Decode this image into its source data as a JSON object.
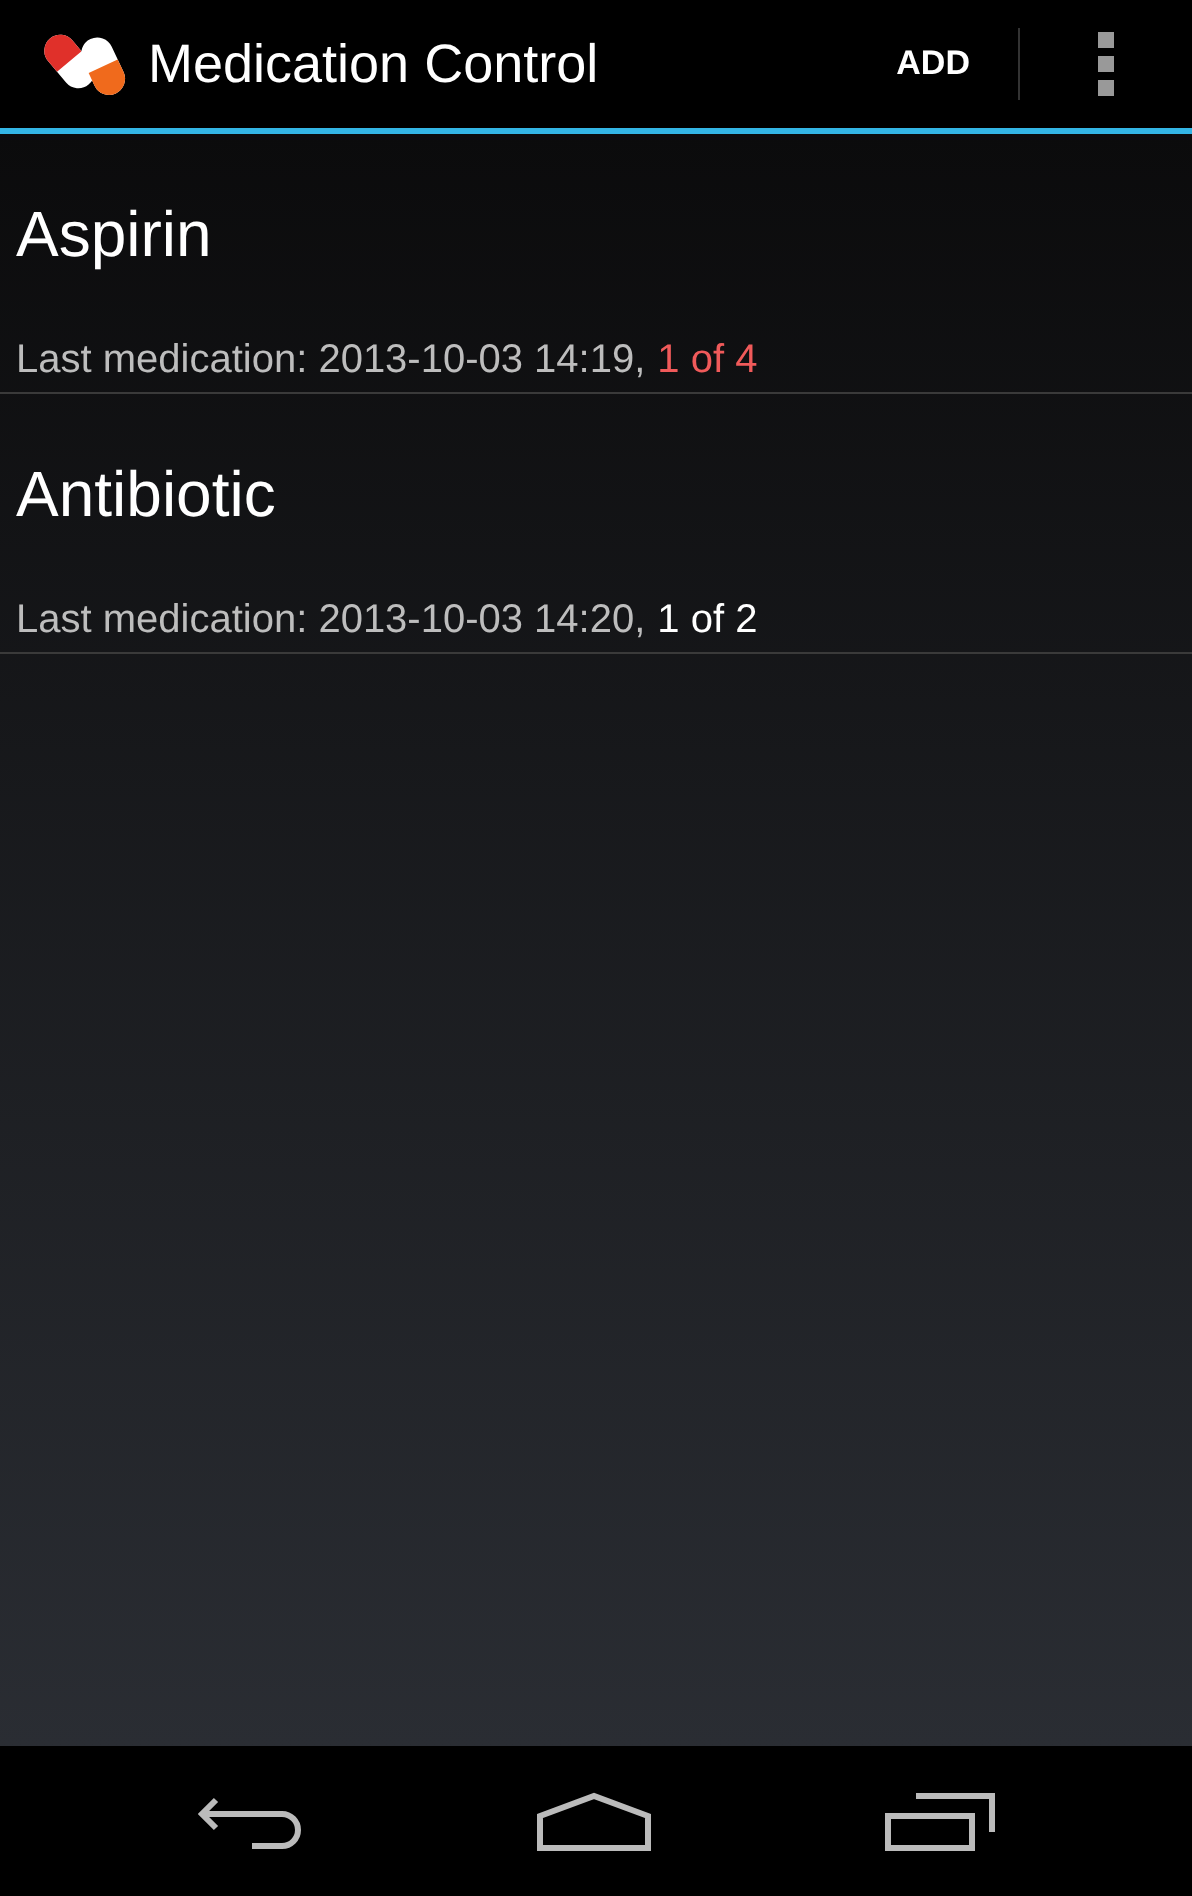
{
  "action_bar": {
    "title": "Medication Control",
    "actions": [
      "ADD"
    ]
  },
  "medications": [
    {
      "name": "Aspirin",
      "summary": "Last medication: 2013-10-03 14:19,",
      "count": "1 of 4",
      "overdue": true
    },
    {
      "name": "Antibiotic",
      "summary": "Last medication: 2013-10-03 14:20,",
      "count": "1 of 2",
      "overdue": false
    }
  ]
}
